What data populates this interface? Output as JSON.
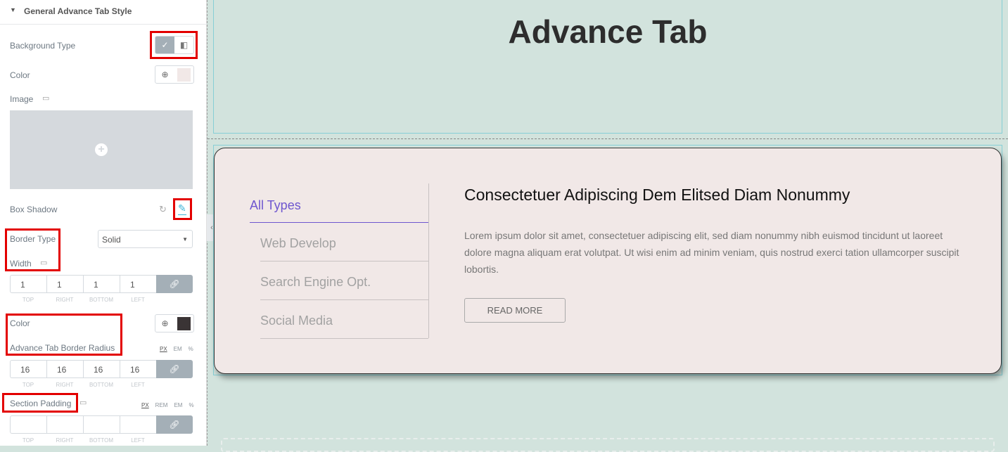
{
  "panel": {
    "section_title": "General Advance Tab Style",
    "background_type_label": "Background Type",
    "color_label": "Color",
    "color_value": "#f1e8e7",
    "image_label": "Image",
    "box_shadow_label": "Box Shadow",
    "border_type_label": "Border Type",
    "border_type_value": "Solid",
    "width_label": "Width",
    "width_values": [
      "1",
      "1",
      "1",
      "1"
    ],
    "dim_labels": [
      "TOP",
      "RIGHT",
      "BOTTOM",
      "LEFT"
    ],
    "border_color_label": "Color",
    "border_color_value": "#3a3435",
    "radius_label": "Advance Tab Border Radius",
    "radius_units": [
      "PX",
      "EM",
      "%"
    ],
    "radius_values": [
      "16",
      "16",
      "16",
      "16"
    ],
    "padding_label": "Section Padding",
    "padding_units": [
      "PX",
      "REM",
      "EM",
      "%"
    ],
    "padding_values": [
      "",
      "",
      "",
      ""
    ]
  },
  "preview": {
    "heading": "Advance Tab",
    "tabs": [
      "All Types",
      "Web Develop",
      "Search Engine Opt.",
      "Social Media"
    ],
    "active_tab_color": "#6e56cf",
    "content_title": "Consectetuer Adipiscing Dem Elitsed Diam Nonummy",
    "content_text": "Lorem ipsum dolor sit amet, consectetuer adipiscing elit, sed diam nonummy nibh euismod tincidunt ut laoreet dolore magna aliquam erat volutpat. Ut wisi enim ad minim veniam, quis nostrud exerci tation ullamcorper suscipit lobortis.",
    "button_label": "READ MORE"
  }
}
